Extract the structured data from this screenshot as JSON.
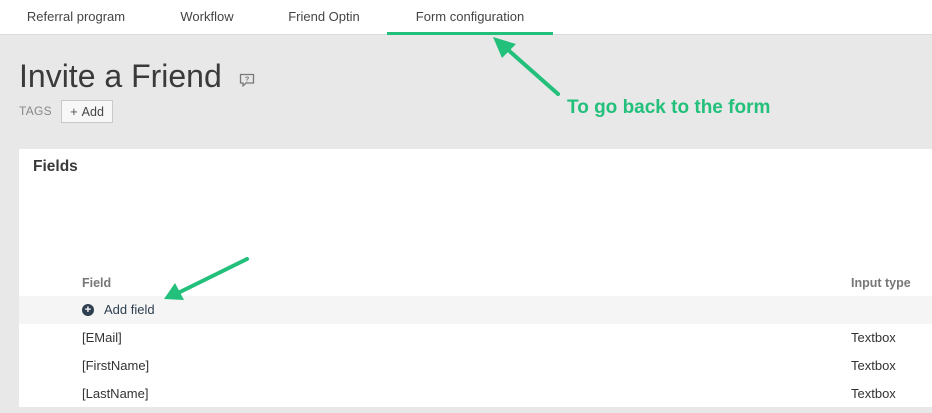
{
  "tabs": [
    {
      "label": "Referral program",
      "active": false
    },
    {
      "label": "Workflow",
      "active": false
    },
    {
      "label": "Friend Optin",
      "active": false
    },
    {
      "label": "Form configuration",
      "active": true
    }
  ],
  "page": {
    "title": "Invite a Friend",
    "help_icon": "help-comment-icon",
    "tags_label": "TAGS",
    "add_tag_label": "Add"
  },
  "annotation": {
    "text": "To go back to the form",
    "color": "#22c07a"
  },
  "fields_panel": {
    "title": "Fields",
    "columns": {
      "field": "Field",
      "input_type": "Input type"
    },
    "add_field_label": "Add field",
    "rows": [
      {
        "field": "[EMail]",
        "input_type": "Textbox"
      },
      {
        "field": "[FirstName]",
        "input_type": "Textbox"
      },
      {
        "field": "[LastName]",
        "input_type": "Textbox"
      }
    ]
  },
  "colors": {
    "accent": "#22c07a",
    "page_background": "#e8e8e8",
    "panel_background": "#ffffff"
  }
}
